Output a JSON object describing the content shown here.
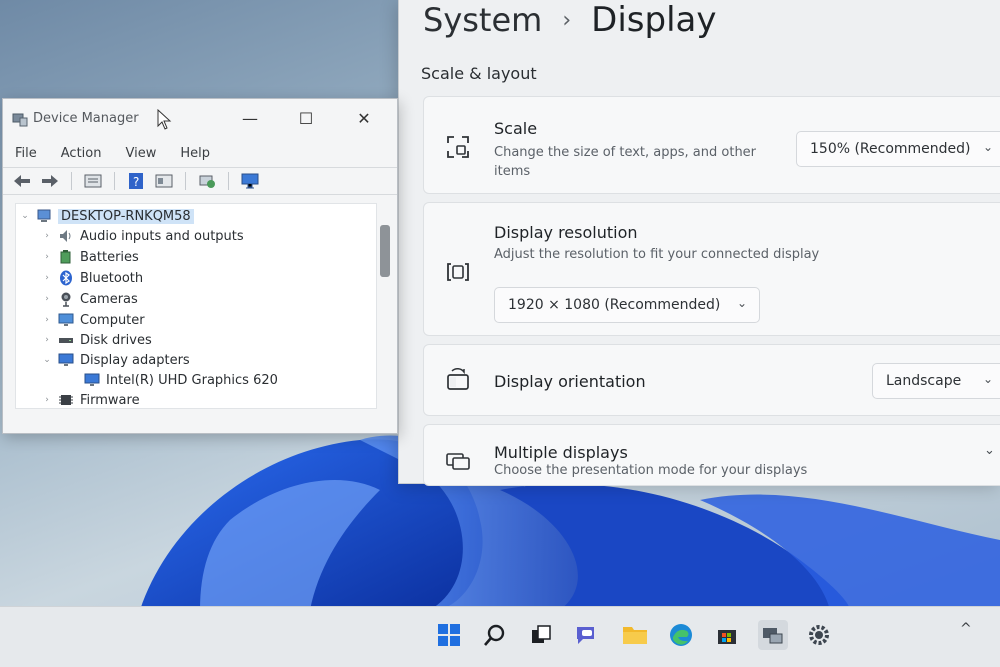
{
  "settings": {
    "breadcrumb_parent": "System",
    "breadcrumb_separator": "›",
    "breadcrumb_current": "Display",
    "section_title": "Scale & layout",
    "scale": {
      "title": "Scale",
      "desc_line1": "Change the size of text, apps, and other",
      "desc_line2": "items",
      "value": "150% (Recommended)"
    },
    "resolution": {
      "title": "Display resolution",
      "desc": "Adjust the resolution to fit your connected display",
      "value": "1920 × 1080 (Recommended)"
    },
    "orientation": {
      "title": "Display orientation",
      "value": "Landscape"
    },
    "multiple": {
      "title": "Multiple displays",
      "desc": "Choose the presentation mode for your displays"
    },
    "chevron": "⌄"
  },
  "device_manager": {
    "title": "Device Manager",
    "window_buttons": {
      "minimize": "—",
      "maximize": "☐",
      "close": "✕"
    },
    "menu": [
      "File",
      "Action",
      "View",
      "Help"
    ],
    "tree": {
      "root": "DESKTOP-RNKQM58",
      "items": [
        {
          "label": "Audio inputs and outputs",
          "icon": "speaker-icon",
          "expanded": false
        },
        {
          "label": "Batteries",
          "icon": "battery-icon",
          "expanded": false
        },
        {
          "label": "Bluetooth",
          "icon": "bluetooth-icon",
          "expanded": false
        },
        {
          "label": "Cameras",
          "icon": "camera-icon",
          "expanded": false
        },
        {
          "label": "Computer",
          "icon": "computer-icon",
          "expanded": false
        },
        {
          "label": "Disk drives",
          "icon": "disk-icon",
          "expanded": false
        },
        {
          "label": "Display adapters",
          "icon": "monitor-icon",
          "expanded": true
        },
        {
          "label": "Intel(R) UHD Graphics 620",
          "icon": "monitor-icon",
          "child": true
        },
        {
          "label": "Firmware",
          "icon": "chip-icon",
          "expanded": false
        }
      ]
    },
    "expander_collapsed": "›",
    "expander_expanded": "⌄"
  },
  "taskbar": {
    "icons": [
      "windows-start-icon",
      "search-icon",
      "task-view-icon",
      "teams-chat-icon",
      "file-explorer-icon",
      "edge-browser-icon",
      "microsoft-store-icon",
      "device-manager-icon",
      "settings-gear-icon"
    ],
    "tray_chevron": "^"
  },
  "colors": {
    "accent": "#0067c0",
    "wallpaper_blue": "#1a4fd0"
  }
}
